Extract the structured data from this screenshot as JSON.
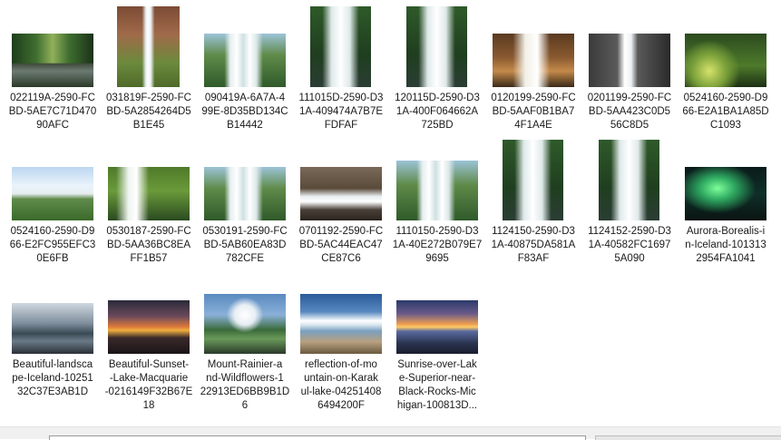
{
  "files": [
    {
      "name": "022119A-2590-FC\nBD-5AE7C71D470\n90AFC"
    },
    {
      "name": "031819F-2590-FC\nBD-5A2854264D5\nB1E45"
    },
    {
      "name": "090419A-6A7A-4\n99E-8D35BD134C\nB14442"
    },
    {
      "name": "111015D-2590-D3\n1A-409474A7B7E\nFDFAF"
    },
    {
      "name": "120115D-2590-D3\n1A-400F064662A\n725BD"
    },
    {
      "name": "0120199-2590-FC\nBD-5AAF0B1BA7\n4F1A4E"
    },
    {
      "name": "0201199-2590-FC\nBD-5AA423C0D5\n56C8D5"
    },
    {
      "name": "0524160-2590-D9\n66-E2A1BA1A85D\nC1093"
    },
    {
      "name": "0524160-2590-D9\n66-E2FC955EFC3\n0E6FB"
    },
    {
      "name": "0530187-2590-FC\nBD-5AA36BC8EA\nFF1B57"
    },
    {
      "name": "0530191-2590-FC\nBD-5AB60EA83D\n782CFE"
    },
    {
      "name": "0701192-2590-FC\nBD-5AC44EAC47\nCE87C6"
    },
    {
      "name": "1110150-2590-D3\n1A-40E272B079E7\n9695"
    },
    {
      "name": "1124150-2590-D3\n1A-40875DA581A\nF83AF"
    },
    {
      "name": "1124152-2590-D3\n1A-40582FC1697\n5A090"
    },
    {
      "name": "Aurora-Borealis-i\nn-Iceland-101313\n2954FA1041"
    },
    {
      "name": "Beautiful-landsca\npe-Iceland-10251\n32C37E3AB1D"
    },
    {
      "name": "Beautiful-Sunset-\n-Lake-Macquarie\n-0216149F32B67E\n18"
    },
    {
      "name": "Mount-Rainier-a\nnd-Wildflowers-1\n22913ED6BB9B1D\n6"
    },
    {
      "name": "reflection-of-mo\nuntain-on-Karak\nul-lake-04251408\n6494200F"
    },
    {
      "name": "Sunrise-over-Lak\ne-Superior-near-\nBlack-Rocks-Mic\nhigan-100813D..."
    }
  ]
}
